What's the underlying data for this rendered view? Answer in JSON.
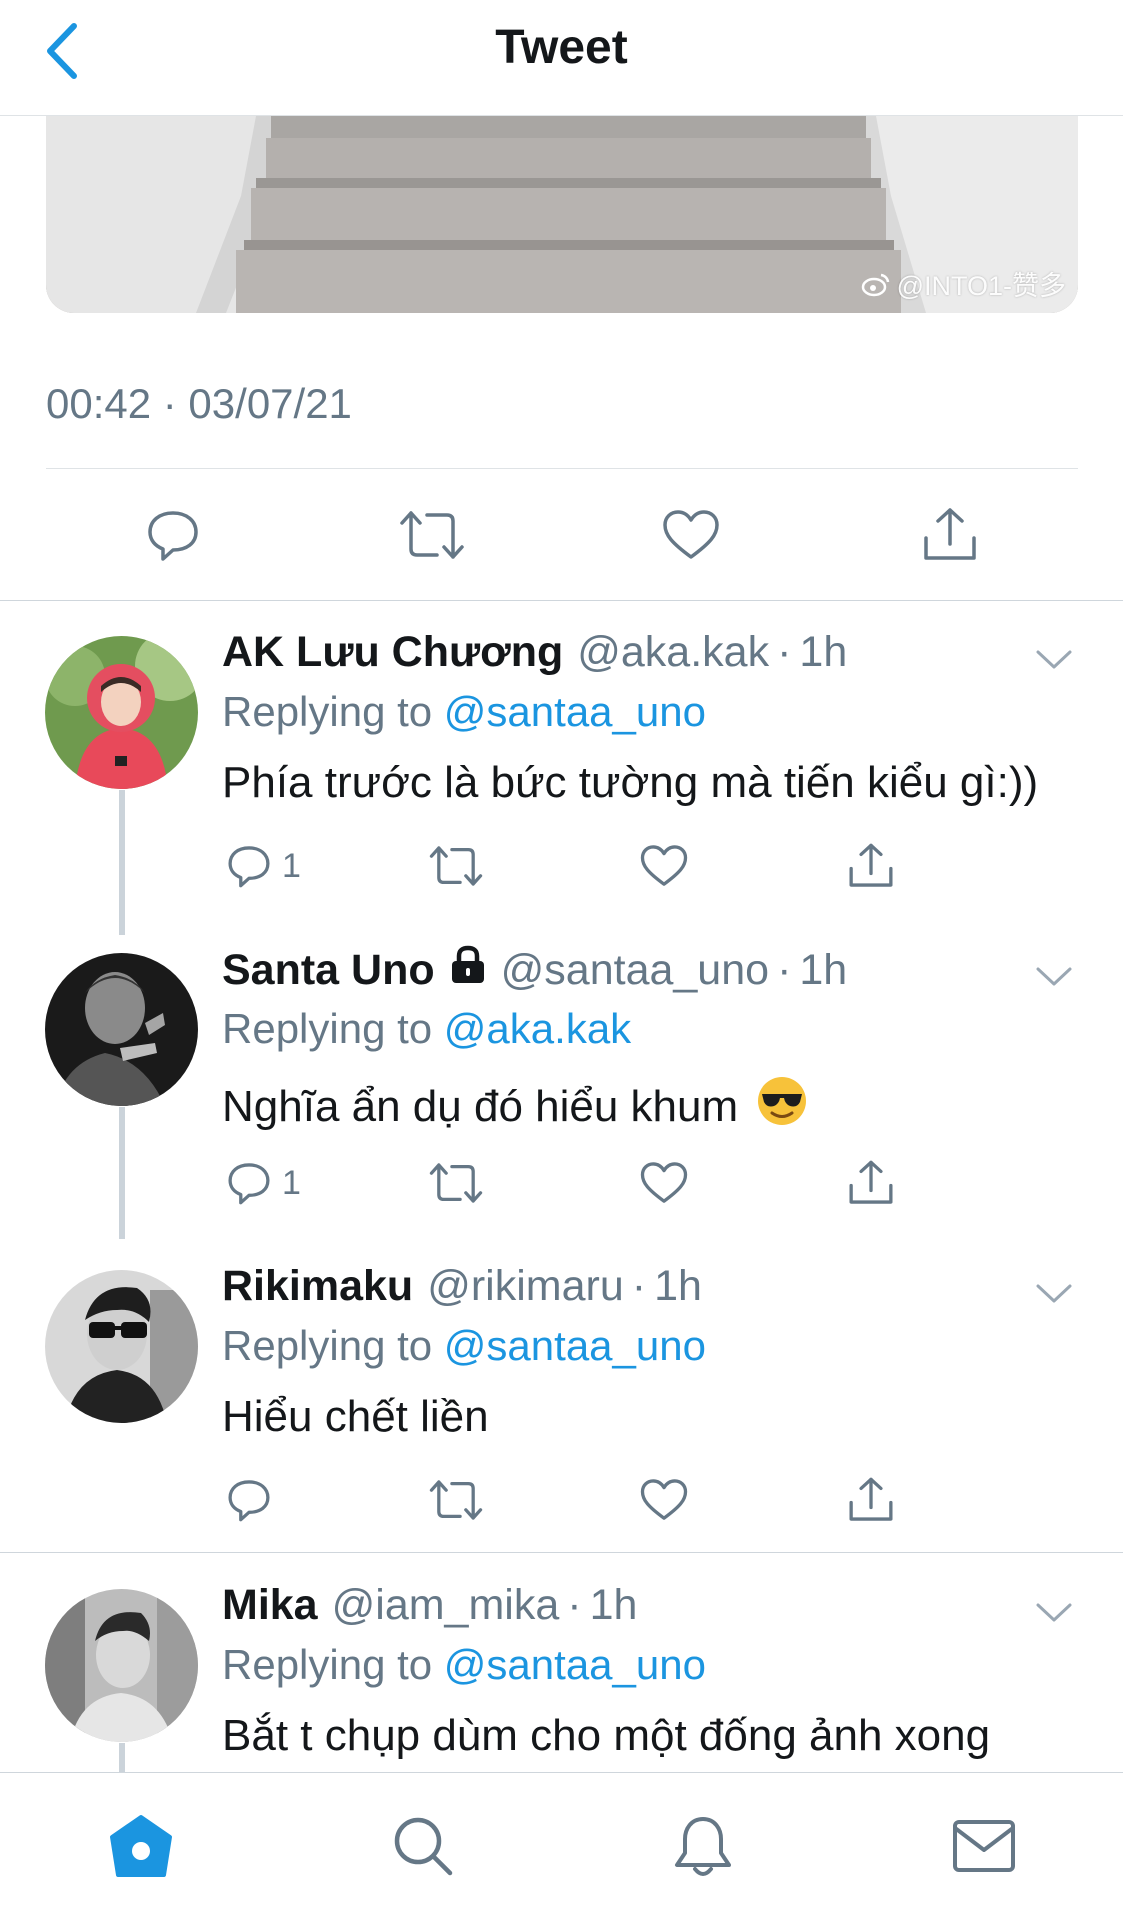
{
  "header": {
    "title": "Tweet"
  },
  "media": {
    "watermark": "@INTO1-赞多"
  },
  "tweet": {
    "timestamp": "00:42 · 03/07/21"
  },
  "colors": {
    "accent": "#1b95e0",
    "secondary_text": "#657786",
    "icon_gray": "#657786",
    "divider": "#dfe3e6"
  },
  "replies": [
    {
      "name": "AK Lưu Chương",
      "handle": "@aka.kak",
      "time": "1h",
      "replying_prefix": "Replying to ",
      "replying_to": "@santaa_uno",
      "text": "Phía trước là bức tường mà tiến kiểu gì:))",
      "reply_count": "1",
      "locked": false
    },
    {
      "name": "Santa Uno",
      "handle": "@santaa_uno",
      "time": "1h",
      "replying_prefix": "Replying to ",
      "replying_to": "@aka.kak",
      "text": "Nghĩa ẩn dụ đó hiểu khum",
      "reply_count": "1",
      "locked": true
    },
    {
      "name": "Rikimaku",
      "handle": "@rikimaru",
      "time": "1h",
      "replying_prefix": "Replying to ",
      "replying_to": "@santaa_uno",
      "text": "Hiểu chết liền",
      "reply_count": "",
      "locked": false
    },
    {
      "name": "Mika",
      "handle": "@iam_mika",
      "time": "1h",
      "replying_prefix": "Replying to ",
      "replying_to": "@santaa_uno",
      "text": "Bắt t chụp dùm cho một đống ảnh xong",
      "reply_count": "",
      "locked": false
    }
  ],
  "icons": {
    "back": "chevron-left-icon",
    "reply": "speech-bubble-icon",
    "retweet": "retweet-icon",
    "like": "heart-icon",
    "share": "share-icon",
    "caret": "chevron-down-icon",
    "lock": "lock-icon",
    "emoji": "sunglasses-emoji",
    "tabs": [
      "home-icon",
      "search-icon",
      "bell-icon",
      "mail-icon"
    ]
  }
}
